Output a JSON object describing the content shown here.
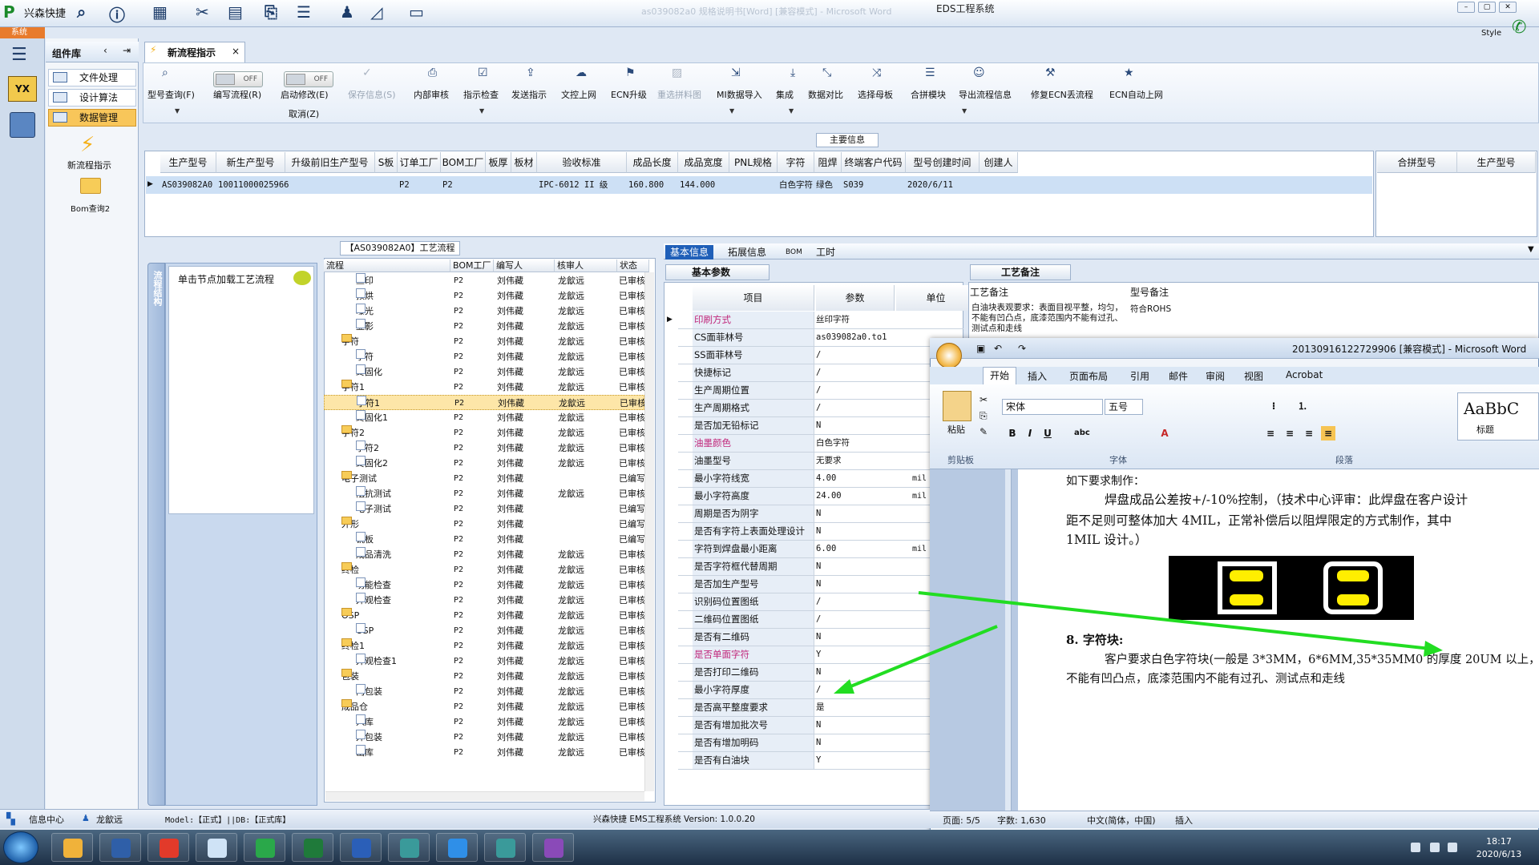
{
  "app": {
    "name": "兴森快捷",
    "title": "EDS工程系统",
    "faded_title": "as039082a0 规格说明书[Word] [兼容模式] - Microsoft Word",
    "sys_tab": "系统",
    "style_label": "Style"
  },
  "component": {
    "header": "组件库",
    "items": [
      "文件处理",
      "设计算法",
      "数据管理"
    ],
    "flow_label": "新流程指示",
    "bom_label": "Bom查询2"
  },
  "main_tab": {
    "label": "新流程指示",
    "close": "×"
  },
  "ribbon": {
    "buttons": [
      {
        "label": "型号查询(F)",
        "icon": "⌕"
      },
      {
        "label": "编写流程(R)",
        "icon": ""
      },
      {
        "label": "启动修改(E)",
        "icon": ""
      },
      {
        "label": "保存信息(S)",
        "icon": "✓"
      },
      {
        "label": "内部审核",
        "icon": "⎙"
      },
      {
        "label": "指示检查",
        "icon": "☑"
      },
      {
        "label": "发送指示",
        "icon": "⇪"
      },
      {
        "label": "文控上网",
        "icon": "☁"
      },
      {
        "label": "ECN升级",
        "icon": "⚑"
      },
      {
        "label": "重选拼料图",
        "icon": "▨"
      },
      {
        "label": "MI数据导入",
        "icon": "⇲"
      },
      {
        "label": "集成",
        "icon": "⤓"
      },
      {
        "label": "数据对比",
        "icon": "⤡"
      },
      {
        "label": "选择母板",
        "icon": "⤨"
      },
      {
        "label": "合拼模块",
        "icon": "☰"
      },
      {
        "label": "导出流程信息",
        "icon": "☺"
      },
      {
        "label": "修复ECN丢流程",
        "icon": "⚒"
      },
      {
        "label": "ECN自动上网",
        "icon": "★"
      }
    ],
    "toggle_off": "OFF",
    "cancel_label": "取消(Z)"
  },
  "main_info": {
    "label": "主要信息",
    "columns": [
      "生产型号",
      "新生产型号",
      "升级前旧生产型号",
      "S板",
      "订单工厂",
      "BOM工厂",
      "板厚",
      "板材",
      "验收标准",
      "成品长度",
      "成品宽度",
      "PNL规格",
      "字符",
      "阻焊",
      "终端客户代码",
      "型号创建时间",
      "创建人"
    ],
    "row": [
      "AS039082A0",
      "10011000025966",
      "",
      "",
      "P2",
      "P2",
      "",
      "",
      "IPC-6012 II 级",
      "160.800",
      "144.000",
      "",
      "白色字符",
      "绿色",
      "S039",
      "2020/6/11",
      ""
    ],
    "right_columns": [
      "合拼型号",
      "生产型号"
    ]
  },
  "workflow": {
    "title": "【AS039082A0】工艺流程",
    "side_label": "流程结构",
    "node_hint": "单击节点加载工艺流程",
    "columns": [
      "流程",
      "BOM工厂",
      "编写人",
      "核审人",
      "状态"
    ],
    "rows": [
      {
        "name": "丝印",
        "lvl": 2,
        "bom": "P2",
        "writer": "刘伟藏",
        "checker": "龙歙远",
        "status": "已审核"
      },
      {
        "name": "预烘",
        "lvl": 2,
        "bom": "P2",
        "writer": "刘伟藏",
        "checker": "龙歙远",
        "status": "已审核"
      },
      {
        "name": "曝光",
        "lvl": 2,
        "bom": "P2",
        "writer": "刘伟藏",
        "checker": "龙歙远",
        "status": "已审核"
      },
      {
        "name": "显影",
        "lvl": 2,
        "bom": "P2",
        "writer": "刘伟藏",
        "checker": "龙歙远",
        "status": "已审核"
      },
      {
        "name": "字符",
        "lvl": 1,
        "bom": "P2",
        "writer": "刘伟藏",
        "checker": "龙歙远",
        "status": "已审核"
      },
      {
        "name": "字符",
        "lvl": 2,
        "bom": "P2",
        "writer": "刘伟藏",
        "checker": "龙歙远",
        "status": "已审核"
      },
      {
        "name": "终固化",
        "lvl": 2,
        "bom": "P2",
        "writer": "刘伟藏",
        "checker": "龙歙远",
        "status": "已审核"
      },
      {
        "name": "字符1",
        "lvl": 1,
        "bom": "P2",
        "writer": "刘伟藏",
        "checker": "龙歙远",
        "status": "已审核"
      },
      {
        "name": "字符1",
        "lvl": 2,
        "bom": "P2",
        "writer": "刘伟藏",
        "checker": "龙歙远",
        "status": "已审核",
        "sel": true
      },
      {
        "name": "终固化1",
        "lvl": 2,
        "bom": "P2",
        "writer": "刘伟藏",
        "checker": "龙歙远",
        "status": "已审核"
      },
      {
        "name": "字符2",
        "lvl": 1,
        "bom": "P2",
        "writer": "刘伟藏",
        "checker": "龙歙远",
        "status": "已审核"
      },
      {
        "name": "字符2",
        "lvl": 2,
        "bom": "P2",
        "writer": "刘伟藏",
        "checker": "龙歙远",
        "status": "已审核"
      },
      {
        "name": "终固化2",
        "lvl": 2,
        "bom": "P2",
        "writer": "刘伟藏",
        "checker": "龙歙远",
        "status": "已审核"
      },
      {
        "name": "电子测试",
        "lvl": 1,
        "bom": "P2",
        "writer": "刘伟藏",
        "checker": "",
        "status": "已编写"
      },
      {
        "name": "阻抗测试",
        "lvl": 2,
        "bom": "P2",
        "writer": "刘伟藏",
        "checker": "龙歙远",
        "status": "已审核"
      },
      {
        "name": "电子测试",
        "lvl": 2,
        "bom": "P2",
        "writer": "刘伟藏",
        "checker": "",
        "status": "已编写"
      },
      {
        "name": "外形",
        "lvl": 1,
        "bom": "P2",
        "writer": "刘伟藏",
        "checker": "",
        "status": "已编写"
      },
      {
        "name": "铣板",
        "lvl": 2,
        "bom": "P2",
        "writer": "刘伟藏",
        "checker": "",
        "status": "已编写"
      },
      {
        "name": "成品清洗",
        "lvl": 2,
        "bom": "P2",
        "writer": "刘伟藏",
        "checker": "龙歙远",
        "status": "已审核"
      },
      {
        "name": "终检",
        "lvl": 1,
        "bom": "P2",
        "writer": "刘伟藏",
        "checker": "龙歙远",
        "status": "已审核"
      },
      {
        "name": "功能检查",
        "lvl": 2,
        "bom": "P2",
        "writer": "刘伟藏",
        "checker": "龙歙远",
        "status": "已审核"
      },
      {
        "name": "外观检查",
        "lvl": 2,
        "bom": "P2",
        "writer": "刘伟藏",
        "checker": "龙歙远",
        "status": "已审核"
      },
      {
        "name": "OSP",
        "lvl": 1,
        "bom": "P2",
        "writer": "刘伟藏",
        "checker": "龙歙远",
        "status": "已审核"
      },
      {
        "name": "OSP",
        "lvl": 2,
        "bom": "P2",
        "writer": "刘伟藏",
        "checker": "龙歙远",
        "status": "已审核"
      },
      {
        "name": "终检1",
        "lvl": 1,
        "bom": "P2",
        "writer": "刘伟藏",
        "checker": "龙歙远",
        "status": "已审核"
      },
      {
        "name": "外观检查1",
        "lvl": 2,
        "bom": "P2",
        "writer": "刘伟藏",
        "checker": "龙歙远",
        "status": "已审核"
      },
      {
        "name": "包装",
        "lvl": 1,
        "bom": "P2",
        "writer": "刘伟藏",
        "checker": "龙歙远",
        "status": "已审核"
      },
      {
        "name": "内包装",
        "lvl": 2,
        "bom": "P2",
        "writer": "刘伟藏",
        "checker": "龙歙远",
        "status": "已审核"
      },
      {
        "name": "成品仓",
        "lvl": 1,
        "bom": "P2",
        "writer": "刘伟藏",
        "checker": "龙歙远",
        "status": "已审核"
      },
      {
        "name": "入库",
        "lvl": 2,
        "bom": "P2",
        "writer": "刘伟藏",
        "checker": "龙歙远",
        "status": "已审核"
      },
      {
        "name": "外包装",
        "lvl": 2,
        "bom": "P2",
        "writer": "刘伟藏",
        "checker": "龙歙远",
        "status": "已审核"
      },
      {
        "name": "出库",
        "lvl": 2,
        "bom": "P2",
        "writer": "刘伟藏",
        "checker": "龙歙远",
        "status": "已审核"
      }
    ]
  },
  "info_tabs": [
    "基本信息",
    "拓展信息",
    "BOM",
    "工时"
  ],
  "params": {
    "label": "基本参数",
    "columns": [
      "项目",
      "参数",
      "单位"
    ],
    "rows": [
      {
        "k": "印刷方式",
        "v": "丝印字符",
        "u": "",
        "pink": true
      },
      {
        "k": "CS面菲林号",
        "v": "as039082a0.to1",
        "u": ""
      },
      {
        "k": "SS面菲林号",
        "v": "/",
        "u": ""
      },
      {
        "k": "快捷标记",
        "v": "/",
        "u": ""
      },
      {
        "k": "生产周期位置",
        "v": "/",
        "u": ""
      },
      {
        "k": "生产周期格式",
        "v": "/",
        "u": ""
      },
      {
        "k": "是否加无铅标记",
        "v": "N",
        "u": ""
      },
      {
        "k": "油墨颜色",
        "v": "白色字符",
        "u": "",
        "pink": true
      },
      {
        "k": "油墨型号",
        "v": "无要求",
        "u": ""
      },
      {
        "k": "最小字符线宽",
        "v": "4.00",
        "u": "mil"
      },
      {
        "k": "最小字符高度",
        "v": "24.00",
        "u": "mil"
      },
      {
        "k": "周期是否为阴字",
        "v": "N",
        "u": ""
      },
      {
        "k": "是否有字符上表面处理设计",
        "v": "N",
        "u": ""
      },
      {
        "k": "字符到焊盘最小距离",
        "v": "6.00",
        "u": "mil"
      },
      {
        "k": "是否字符框代替周期",
        "v": "N",
        "u": ""
      },
      {
        "k": "是否加生产型号",
        "v": "N",
        "u": ""
      },
      {
        "k": "识别码位置图纸",
        "v": "/",
        "u": ""
      },
      {
        "k": "二维码位置图纸",
        "v": "/",
        "u": ""
      },
      {
        "k": "是否有二维码",
        "v": "N",
        "u": ""
      },
      {
        "k": "是否单面字符",
        "v": "Y",
        "u": "",
        "pink": true
      },
      {
        "k": "是否打印二维码",
        "v": "N",
        "u": ""
      },
      {
        "k": "最小字符厚度",
        "v": "/",
        "u": ""
      },
      {
        "k": "是否高平整度要求",
        "v": "是",
        "u": ""
      },
      {
        "k": "是否有增加批次号",
        "v": "N",
        "u": ""
      },
      {
        "k": "是否有增加明码",
        "v": "N",
        "u": ""
      },
      {
        "k": "是否有白油块",
        "v": "Y",
        "u": ""
      }
    ]
  },
  "process_note": {
    "label": "工艺备注",
    "col1": "工艺备注",
    "col2": "型号备注",
    "text1": "白油块表观要求：表面目视平整，均匀，不能有凹凸点，底漆范围内不能有过孔、测试点和走线",
    "text2": "符合ROHS"
  },
  "word": {
    "title": "20130916122729906 [兼容模式] - Microsoft Word",
    "tabs": [
      "开始",
      "插入",
      "页面布局",
      "引用",
      "邮件",
      "审阅",
      "视图",
      "Acrobat"
    ],
    "font": "宋体",
    "size": "五号",
    "paste": "粘贴",
    "groups": [
      "剪贴板",
      "字体",
      "段落"
    ],
    "style_sample": "AaBbC",
    "style_name": "标题",
    "lines": [
      "如下要求制作：",
      "焊盘成品公差按+/-10%控制，（技术中心评审：此焊盘在客户设计",
      "距不足则可整体加大 4MIL，正常补偿后以阻焊限定的方式制作，其中",
      "1MIL 设计。）",
      "8. 字符块:",
      "客户要求白色字符块(一般是 3*3MM，6*6MM,35*35MM0 的厚度 20UM 以上，",
      "不能有凹凸点，底漆范围内不能有过孔、测试点和走线"
    ],
    "status": {
      "page": "页面: 5/5",
      "words": "字数: 1,630",
      "lang": "中文(简体，中国)",
      "mode": "插入"
    }
  },
  "statusbar": {
    "info": "信息中心",
    "user": "龙歙远",
    "model": "Model:【正式】||DB:【正式库】",
    "version": "兴森快捷 EMS工程系统 Version: 1.0.0.20"
  },
  "clock": {
    "time": "18:17",
    "date": "2020/6/13"
  },
  "colors": {
    "accent": "#1f5fb8",
    "selected": "#fde6a8",
    "arrow": "#22dd22"
  }
}
